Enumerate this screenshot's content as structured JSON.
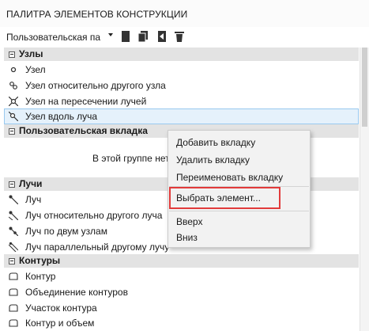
{
  "window": {
    "title": "ПАЛИТРА ЭЛЕМЕНТОВ КОНСТРУКЦИИ"
  },
  "toolbar": {
    "palette_select": "Пользовательская па"
  },
  "groups": {
    "nodes": {
      "label": "Узлы",
      "items": [
        "Узел",
        "Узел относительно другого узла",
        "Узел на пересечении лучей",
        "Узел вдоль луча"
      ]
    },
    "custom": {
      "label": "Пользовательская вкладка",
      "hint": "В этой группе нет"
    },
    "rays": {
      "label": "Лучи",
      "items": [
        "Луч",
        "Луч относительно другого луча",
        "Луч по двум узлам",
        "Луч параллельный другому лучу"
      ]
    },
    "contours": {
      "label": "Контуры",
      "items": [
        "Контур",
        "Объединение контуров",
        "Участок контура",
        "Контур и объем"
      ]
    }
  },
  "context_menu": {
    "items": [
      "Добавить вкладку",
      "Удалить вкладку",
      "Переименовать вкладку",
      "Выбрать элемент...",
      "Вверх",
      "Вниз"
    ]
  },
  "colors": {
    "highlight_box": "#e23b3b",
    "selection": "#e5f1fb",
    "group_header": "#e3e3e3"
  }
}
